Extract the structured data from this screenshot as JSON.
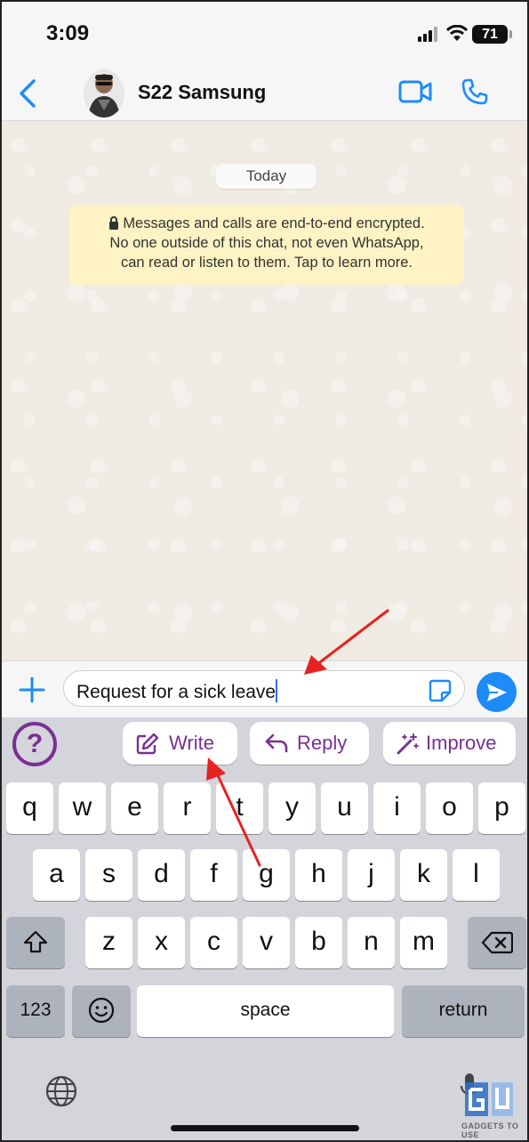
{
  "status_bar": {
    "time": "3:09",
    "battery": "71"
  },
  "header": {
    "contact_name": "S22 Samsung"
  },
  "chat": {
    "date_chip": "Today",
    "encryption_notice": [
      "Messages and calls are end-to-end encrypted.",
      "No one outside of this chat, not even WhatsApp,",
      "can read or listen to them. Tap to learn more."
    ]
  },
  "composer": {
    "text": "Request for a sick leave"
  },
  "ai_toolbar": {
    "help": "?",
    "write": "Write",
    "reply": "Reply",
    "improve": "Improve"
  },
  "keyboard": {
    "row1": [
      "q",
      "w",
      "e",
      "r",
      "t",
      "y",
      "u",
      "i",
      "o",
      "p"
    ],
    "row2": [
      "a",
      "s",
      "d",
      "f",
      "g",
      "h",
      "j",
      "k",
      "l"
    ],
    "row3": [
      "z",
      "x",
      "c",
      "v",
      "b",
      "n",
      "m"
    ],
    "numbers": "123",
    "space": "space",
    "return": "return"
  },
  "watermark": "GADGETS TO USE",
  "colors": {
    "accent": "#1d8cf8",
    "ai_purple": "#7a2f93",
    "annotation_red": "#e62222",
    "notice_bg": "#fdf3c4"
  }
}
